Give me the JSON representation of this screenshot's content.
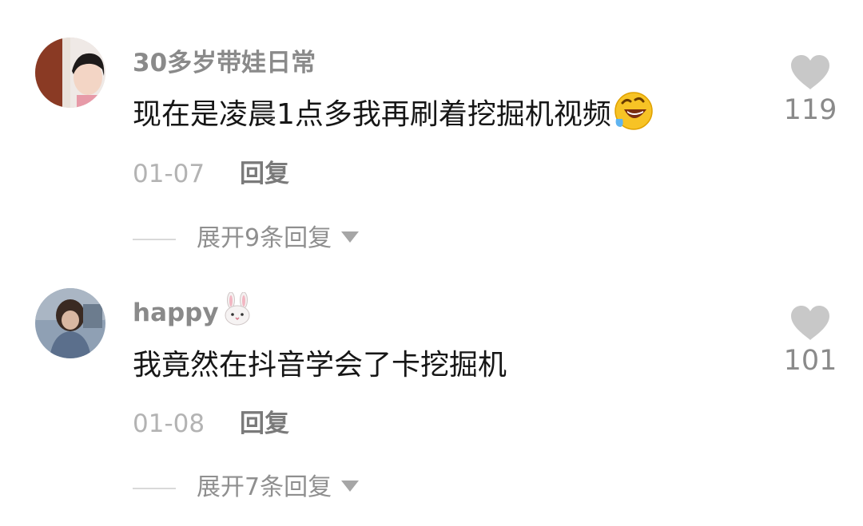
{
  "comments": [
    {
      "username": "30多岁带娃日常",
      "username_suffix_icon": "",
      "text": "现在是凌晨1点多我再刷着挖掘机视频",
      "trailing_emoji": "rolling-on-floor-laughing-emoji",
      "date": "01-07",
      "reply_label": "回复",
      "expand_label": "展开9条回复",
      "likes": "119"
    },
    {
      "username": "happy",
      "username_suffix_icon": "rabbit-face-emoji",
      "text": "我竟然在抖音学会了卡挖掘机",
      "trailing_emoji": "",
      "date": "01-08",
      "reply_label": "回复",
      "expand_label": "展开7条回复",
      "likes": "101"
    }
  ],
  "colors": {
    "text_primary": "#161616",
    "username": "#8a8a8a",
    "date": "#b3b3b3",
    "reply": "#7a7a7a",
    "heart": "#c8c8c8"
  }
}
